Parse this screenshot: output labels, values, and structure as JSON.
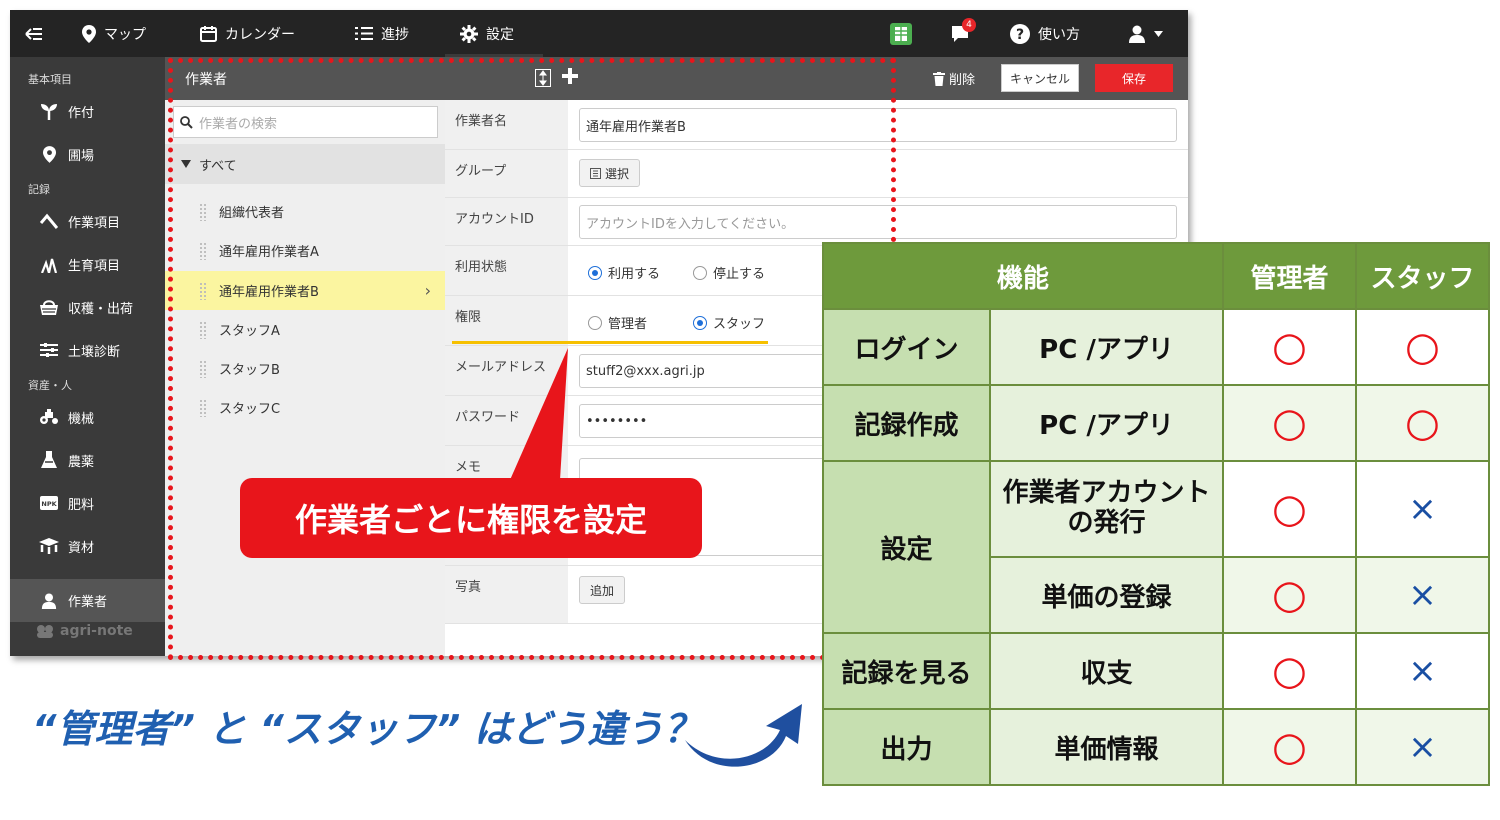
{
  "topbar": {
    "nav": [
      {
        "label": "マップ",
        "icon": "map-pin-icon"
      },
      {
        "label": "カレンダー",
        "icon": "calendar-icon"
      },
      {
        "label": "進捗",
        "icon": "list-icon"
      },
      {
        "label": "設定",
        "icon": "gear-icon"
      }
    ],
    "help_label": "使い方",
    "notification_count": "4"
  },
  "sidebar": {
    "sections": [
      "基本項目",
      "記録",
      "資産・人"
    ],
    "items": [
      {
        "label": "作付",
        "icon": "sprout-icon"
      },
      {
        "label": "圃場",
        "icon": "map-pin-icon"
      },
      {
        "label": "作業項目",
        "icon": "hoe-icon"
      },
      {
        "label": "生育項目",
        "icon": "growth-icon"
      },
      {
        "label": "収穫・出荷",
        "icon": "basket-icon"
      },
      {
        "label": "土壌診断",
        "icon": "sliders-icon"
      },
      {
        "label": "機械",
        "icon": "tractor-icon"
      },
      {
        "label": "農薬",
        "icon": "flask-icon"
      },
      {
        "label": "肥料",
        "icon": "fertilizer-icon"
      },
      {
        "label": "資材",
        "icon": "materials-icon"
      },
      {
        "label": "作業者",
        "icon": "user-icon"
      }
    ],
    "logo": "agri-note"
  },
  "subbar": {
    "title": "作業者",
    "delete_label": "削除",
    "cancel_label": "キャンセル",
    "save_label": "保存"
  },
  "list": {
    "search_placeholder": "作業者の検索",
    "root_label": "すべて",
    "items": [
      "組織代表者",
      "通年雇用作業者A",
      "通年雇用作業者B",
      "スタッフA",
      "スタッフB",
      "スタッフC"
    ],
    "selected_index": 2
  },
  "form": {
    "name_label": "作業者名",
    "name_value": "通年雇用作業者B",
    "group_label": "グループ",
    "group_button": "選択",
    "account_label": "アカウントID",
    "account_placeholder": "アカウントIDを入力してください。",
    "status_label": "利用状態",
    "status_options": [
      "利用する",
      "停止する"
    ],
    "status_selected": "利用する",
    "role_label": "権限",
    "role_options": [
      "管理者",
      "スタッフ"
    ],
    "role_selected": "スタッフ",
    "email_label": "メールアドレス",
    "email_value": "stuff2@xxx.agri.jp",
    "password_label": "パスワード",
    "password_value": "••••••••",
    "memo_label": "メモ",
    "photo_label": "写真",
    "photo_button": "追加"
  },
  "callout": "作業者ごとに権限を設定",
  "question": "“管理者” と “スタッフ” はどう違う？",
  "table": {
    "headers": [
      "機能",
      "管理者",
      "スタッフ"
    ],
    "rows": [
      {
        "category": "ログイン",
        "feature": "PC /アプリ",
        "admin": "○",
        "staff": "○"
      },
      {
        "category": "記録作成",
        "feature": "PC /アプリ",
        "admin": "○",
        "staff": "○"
      },
      {
        "category": "設定",
        "feature": "作業者アカウント\nの発行",
        "admin": "○",
        "staff": "×"
      },
      {
        "category": "",
        "feature": "単価の登録",
        "admin": "○",
        "staff": "×"
      },
      {
        "category": "記録を見る",
        "feature": "収支",
        "admin": "○",
        "staff": "×"
      },
      {
        "category": "出力",
        "feature": "単価情報",
        "admin": "○",
        "staff": "×"
      }
    ]
  },
  "colors": {
    "accent_red": "#e8151b",
    "table_header": "#6e9a3c",
    "radio_blue": "#1e6fd9",
    "question_blue": "#1f5fb0"
  }
}
